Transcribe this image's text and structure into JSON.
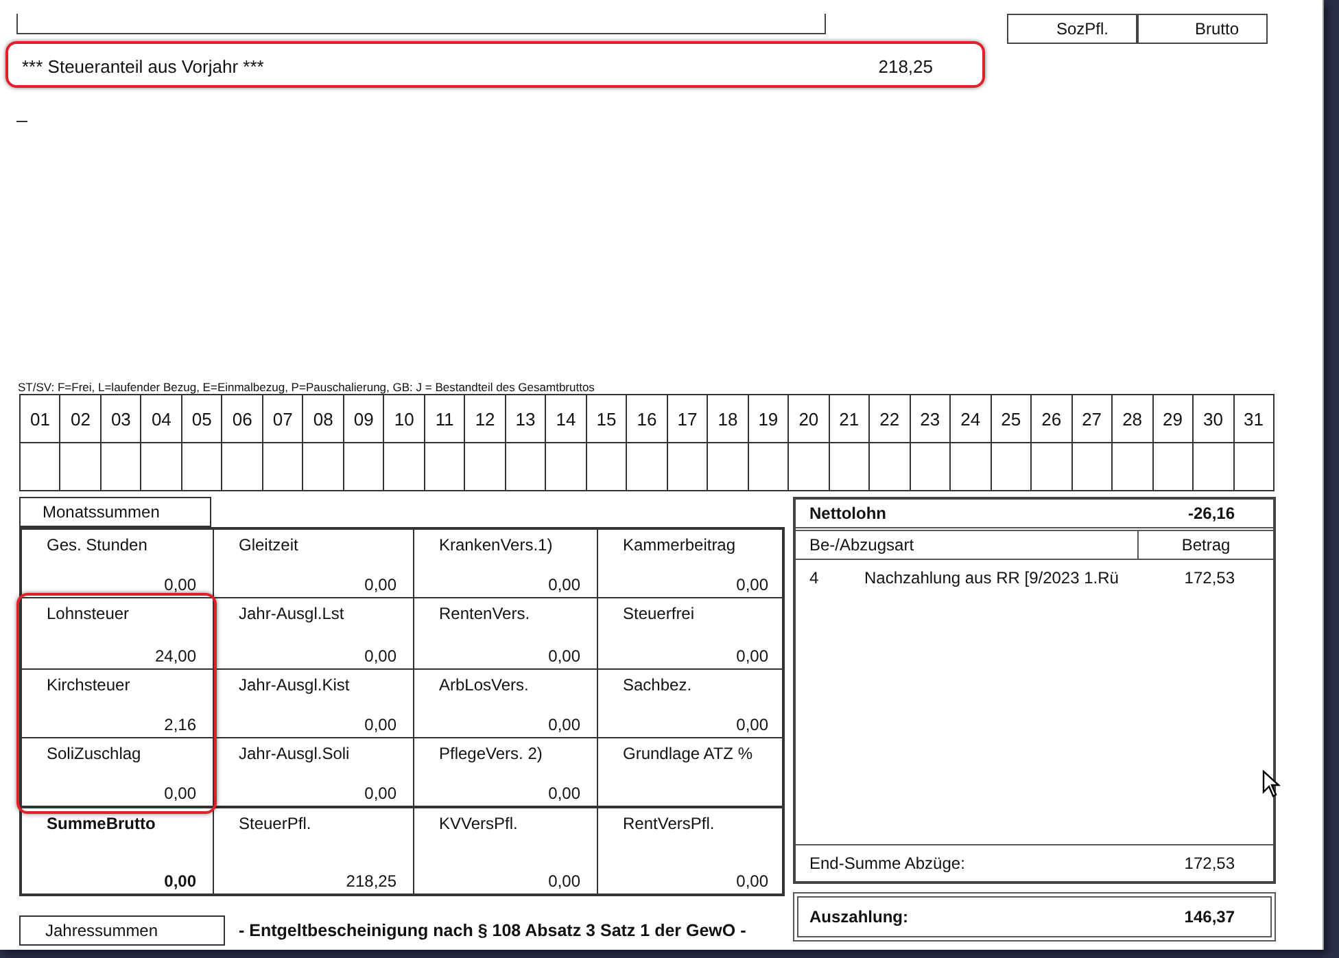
{
  "header": {
    "columns": [
      "SozPfl.",
      "Brutto"
    ]
  },
  "rows": [
    {
      "text": "*** Steueranteil aus Vorjahr ***",
      "amount": "218,25",
      "highlighted": true
    }
  ],
  "legend": "ST/SV: F=Frei, L=laufender Bezug, E=Einmalbezug, P=Pauschalierung,  GB: J = Bestandteil des Gesamtbruttos",
  "days": [
    "01",
    "02",
    "03",
    "04",
    "05",
    "06",
    "07",
    "08",
    "09",
    "10",
    "11",
    "12",
    "13",
    "14",
    "15",
    "16",
    "17",
    "18",
    "19",
    "20",
    "21",
    "22",
    "23",
    "24",
    "25",
    "26",
    "27",
    "28",
    "29",
    "30",
    "31"
  ],
  "monthly": {
    "title": "Monatssummen",
    "rows": [
      [
        {
          "label": "Ges. Stunden",
          "value": "0,00",
          "bold": false,
          "highlighted": false
        },
        {
          "label": "Gleitzeit",
          "value": "0,00",
          "bold": false,
          "highlighted": false
        },
        {
          "label": "KrankenVers.1)",
          "value": "0,00",
          "bold": false,
          "highlighted": false
        },
        {
          "label": "Kammerbeitrag",
          "value": "0,00",
          "bold": false,
          "highlighted": false
        }
      ],
      [
        {
          "label": "Lohnsteuer",
          "value": "24,00",
          "bold": false,
          "highlighted": true
        },
        {
          "label": "Jahr-Ausgl.Lst",
          "value": "0,00",
          "bold": false,
          "highlighted": false
        },
        {
          "label": "RentenVers.",
          "value": "0,00",
          "bold": false,
          "highlighted": false
        },
        {
          "label": "Steuerfrei",
          "value": "0,00",
          "bold": false,
          "highlighted": false
        }
      ],
      [
        {
          "label": "Kirchsteuer",
          "value": "2,16",
          "bold": false,
          "highlighted": true
        },
        {
          "label": "Jahr-Ausgl.Kist",
          "value": "0,00",
          "bold": false,
          "highlighted": false
        },
        {
          "label": "ArbLosVers.",
          "value": "0,00",
          "bold": false,
          "highlighted": false
        },
        {
          "label": "Sachbez.",
          "value": "0,00",
          "bold": false,
          "highlighted": false
        }
      ],
      [
        {
          "label": "SoliZuschlag",
          "value": "0,00",
          "bold": false,
          "highlighted": true
        },
        {
          "label": "Jahr-Ausgl.Soli",
          "value": "0,00",
          "bold": false,
          "highlighted": false
        },
        {
          "label": "PflegeVers.   2)",
          "value": "0,00",
          "bold": false,
          "highlighted": false
        },
        {
          "label": "Grundlage ATZ %",
          "bold": false,
          "highlighted": false
        }
      ],
      [
        {
          "label": "SummeBrutto",
          "value": "0,00",
          "bold": true,
          "highlighted": false
        },
        {
          "label": "SteuerPfl.",
          "value": "218,25",
          "bold": false,
          "highlighted": false
        },
        {
          "label": "KVVersPfl.",
          "value": "0,00",
          "bold": false,
          "highlighted": false
        },
        {
          "label": "RentVersPfl.",
          "value": "0,00",
          "bold": false,
          "highlighted": false
        }
      ]
    ]
  },
  "annual": {
    "title": "Jahressummen",
    "note": "- Entgeltbescheinigung nach § 108 Absatz 3 Satz 1 der GewO -"
  },
  "net": {
    "label": "Nettolohn",
    "value": "-26,16",
    "columns": [
      "Be-/Abzugsart",
      "Betrag"
    ],
    "items": [
      {
        "number": "4",
        "text": "Nachzahlung aus RR [9/2023 1.Rü",
        "amount": "172,53"
      }
    ],
    "total_label": "End-Summe Abzüge:",
    "total": "172,53",
    "payout_label": "Auszahlung:",
    "payout": "146,37"
  }
}
